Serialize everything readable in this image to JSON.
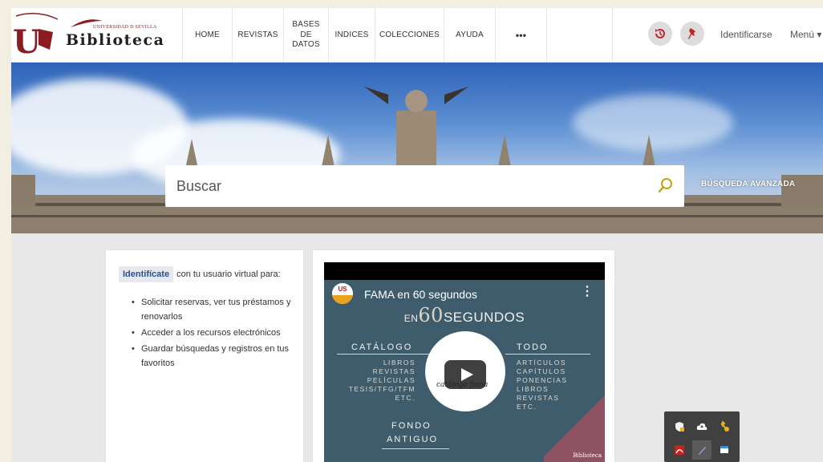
{
  "header": {
    "logo": {
      "university": "UNIVERSIDAD D SEVILLA",
      "name": "Biblioteca",
      "seal_text": "UNIVERSIDAD DE SEVILLA"
    },
    "nav": [
      {
        "label": "HOME"
      },
      {
        "label": "REVISTAS"
      },
      {
        "label": "BASES DE DATOS"
      },
      {
        "label": "INDICES"
      },
      {
        "label": "COLECCIONES"
      },
      {
        "label": "AYUDA"
      },
      {
        "label": "•••"
      }
    ],
    "login": "Identificarse",
    "menu": "Menú ▾"
  },
  "search": {
    "placeholder": "Buscar",
    "advanced": "BÚSQUEDA AVANZADA"
  },
  "login_panel": {
    "button": "Identifícate",
    "text": "con tu usuario virtual para:",
    "items": [
      "Solicitar reservas, ver tus préstamos y renovarlos",
      "Acceder a los recursos electrónicos",
      "Guardar búsquedas y registros en tus favoritos"
    ]
  },
  "video": {
    "title": "FAMA en 60 segundos",
    "channel_badge": "US",
    "heading_prefix": "EN",
    "heading_number": "60",
    "heading_suffix": "SEGUNDOS",
    "catalogo": "CATÁLOGO",
    "catalogo_items": [
      "LIBROS",
      "REVISTAS",
      "PELÍCULAS",
      "TESIS/TFG/TFM",
      "ETC."
    ],
    "todo": "TODO",
    "todo_items": [
      "ARTÍCULOS",
      "CAPÍTULOS",
      "PONENCIAS",
      "LIBROS",
      "REVISTAS",
      "ETC."
    ],
    "fondo": "FONDO",
    "antiguo": "ANTIGUO",
    "logo_text": "catálogo fama",
    "corner_text": "Biblioteca"
  },
  "colors": {
    "brand": "#8b1c22",
    "link": "#2a4e8f",
    "video_bg": "#3e5c6c"
  }
}
